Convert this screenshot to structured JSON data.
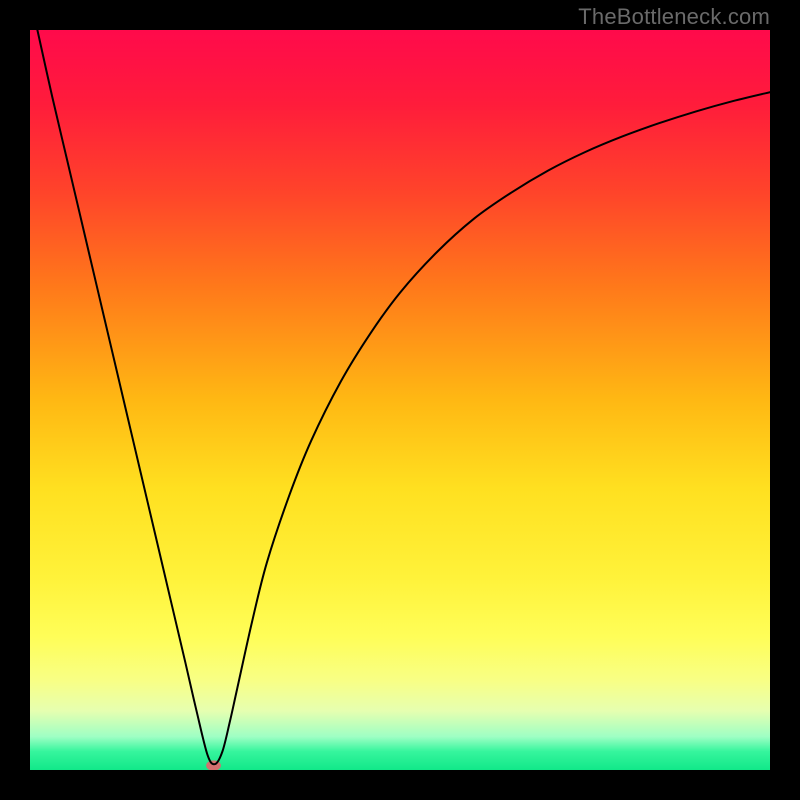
{
  "watermark": "TheBottleneck.com",
  "chart_data": {
    "type": "line",
    "title": "",
    "xlabel": "",
    "ylabel": "",
    "xlim": [
      0,
      100
    ],
    "ylim": [
      0,
      100
    ],
    "grid": false,
    "legend": false,
    "gradient_stops": [
      {
        "offset": 0.0,
        "color": "#ff0a4b"
      },
      {
        "offset": 0.1,
        "color": "#ff1c3b"
      },
      {
        "offset": 0.22,
        "color": "#ff442a"
      },
      {
        "offset": 0.35,
        "color": "#ff7a1a"
      },
      {
        "offset": 0.5,
        "color": "#ffb813"
      },
      {
        "offset": 0.62,
        "color": "#ffe020"
      },
      {
        "offset": 0.74,
        "color": "#fff23a"
      },
      {
        "offset": 0.82,
        "color": "#fffe58"
      },
      {
        "offset": 0.88,
        "color": "#f8ff86"
      },
      {
        "offset": 0.92,
        "color": "#e6ffb0"
      },
      {
        "offset": 0.955,
        "color": "#9effc4"
      },
      {
        "offset": 0.975,
        "color": "#36f59d"
      },
      {
        "offset": 1.0,
        "color": "#11e889"
      }
    ],
    "series": [
      {
        "name": "bottleneck-curve",
        "stroke": "#000000",
        "stroke_width": 2,
        "x": [
          1,
          3,
          5,
          7,
          9,
          11,
          13,
          15,
          17,
          19,
          21,
          22.5,
          24,
          25,
          26,
          27,
          28,
          30,
          32,
          35,
          38,
          42,
          46,
          50,
          55,
          60,
          65,
          70,
          75,
          80,
          85,
          90,
          95,
          100
        ],
        "y": [
          100,
          91,
          82.5,
          74,
          65.5,
          57,
          48.5,
          40,
          31.5,
          23,
          14.5,
          8,
          2,
          0.8,
          2.5,
          6.5,
          11,
          20,
          28,
          37,
          44.5,
          52.5,
          59,
          64.5,
          70,
          74.5,
          78,
          81,
          83.5,
          85.6,
          87.4,
          89,
          90.4,
          91.6
        ]
      }
    ],
    "markers": [
      {
        "name": "optimum-marker",
        "x": 24.8,
        "y": 0.6,
        "rx": 1.0,
        "ry": 0.7,
        "fill": "#d1706f"
      }
    ]
  }
}
